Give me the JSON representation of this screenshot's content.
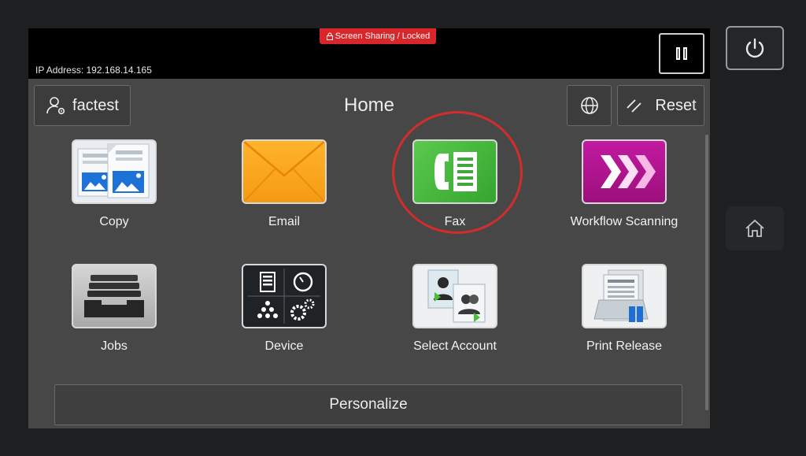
{
  "topbar": {
    "lock_banner": "Screen Sharing / Locked",
    "ip_address": "IP Address: 192.168.14.165"
  },
  "header": {
    "user_name": "factest",
    "title": "Home",
    "reset_label": "Reset"
  },
  "apps": [
    {
      "label": "Copy",
      "icon": "copy-icon"
    },
    {
      "label": "Email",
      "icon": "email-icon"
    },
    {
      "label": "Fax",
      "icon": "fax-icon"
    },
    {
      "label": "Workflow Scanning",
      "icon": "workflow-scanning-icon"
    },
    {
      "label": "Jobs",
      "icon": "jobs-icon"
    },
    {
      "label": "Device",
      "icon": "device-icon"
    },
    {
      "label": "Select Account",
      "icon": "select-account-icon"
    },
    {
      "label": "Print Release",
      "icon": "print-release-icon"
    }
  ],
  "footer": {
    "personalize_label": "Personalize"
  },
  "colors": {
    "accent_red": "#d9262a",
    "fax_green": "#3fb23a",
    "email_orange": "#f7a11a",
    "workflow_magenta": "#b0148c"
  }
}
